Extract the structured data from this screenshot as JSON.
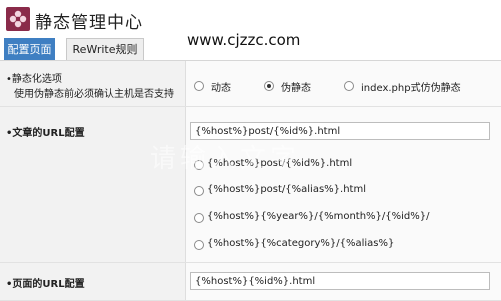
{
  "header": {
    "title": "静态管理中心",
    "site_url": "www.cjzzc.com",
    "logo_icon": "flower-logo-icon"
  },
  "tabs": [
    {
      "label": "配置页面",
      "active": true
    },
    {
      "label": "ReWrite规则",
      "active": false
    }
  ],
  "rows": {
    "static_option": {
      "label": "•静态化选项",
      "sublabel": "使用伪静态前必须确认主机是否支持",
      "options": [
        {
          "label": "动态",
          "checked": false
        },
        {
          "label": "伪静态",
          "checked": true
        },
        {
          "label": "index.php式仿伪静态",
          "checked": false
        }
      ]
    },
    "article_url": {
      "label": "•文章的URL配置",
      "input_value": "{%host%}post/{%id%}.html",
      "options": [
        {
          "label": "{%host%}post/{%id%}.html",
          "checked": false
        },
        {
          "label": "{%host%}post/{%alias%}.html",
          "checked": false
        },
        {
          "label": "{%host%}{%year%}/{%month%}/{%id%}/",
          "checked": false
        },
        {
          "label": "{%host%}{%category%}/{%alias%}",
          "checked": false
        }
      ]
    },
    "page_url": {
      "label": "•页面的URL配置",
      "input_value": "{%host%}{%id%}.html"
    }
  },
  "watermark": "请输入文字"
}
